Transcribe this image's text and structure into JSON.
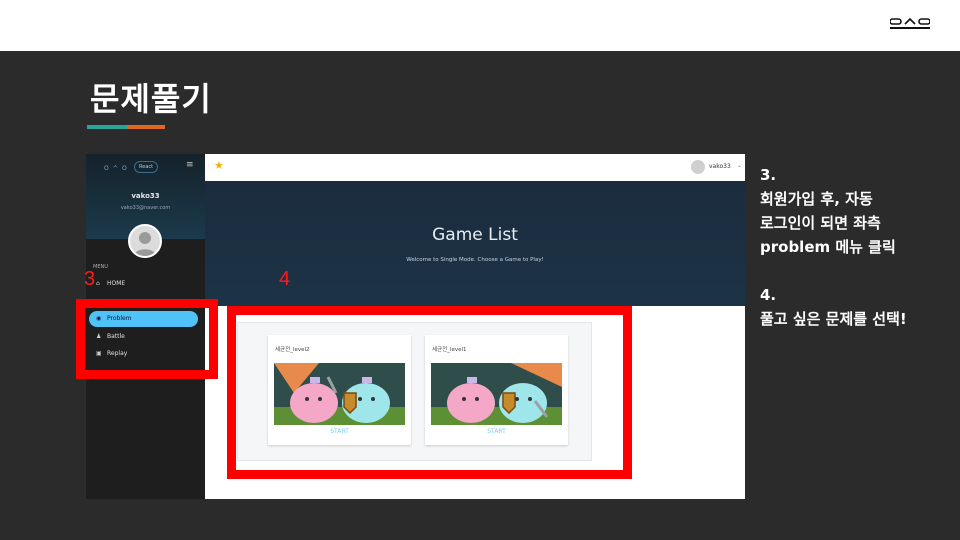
{
  "slide": {
    "title": "문제풀기",
    "logo_icon": "ssafy-logo-icon",
    "accent_colors": [
      "#2aa39a",
      "#e2661e"
    ]
  },
  "screenshot": {
    "sidebar": {
      "brand": "O ᄉ O",
      "framework_badge": "React",
      "username": "vako33",
      "email": "vako33@naver.com",
      "menu_label": "MENU",
      "items": [
        {
          "label": "HOME",
          "icon": "home-icon"
        },
        {
          "label": "Problem",
          "icon": "eye-icon",
          "active": true
        },
        {
          "label": "Battle",
          "icon": "person-icon"
        },
        {
          "label": "Replay",
          "icon": "film-icon"
        }
      ]
    },
    "topbar": {
      "star_icon": "star-icon",
      "username": "vako33",
      "caret": "⌄"
    },
    "banner": {
      "title": "Game List",
      "subtitle": "Welcome to Single Mode. Choose a Game to Play!"
    },
    "games": [
      {
        "title": "세균전_level2",
        "start_label": "START"
      },
      {
        "title": "세균전_level1",
        "start_label": "START"
      }
    ]
  },
  "callouts": {
    "marker_3": "3",
    "marker_4": "4",
    "highlight_color": "#ff0000"
  },
  "notes": {
    "lines": [
      "3.",
      "회원가입 후, 자동",
      "로그인이 되면 좌측",
      "problem 메뉴 클릭",
      "",
      "4.",
      "풀고 싶은 문제를 선택!"
    ]
  }
}
